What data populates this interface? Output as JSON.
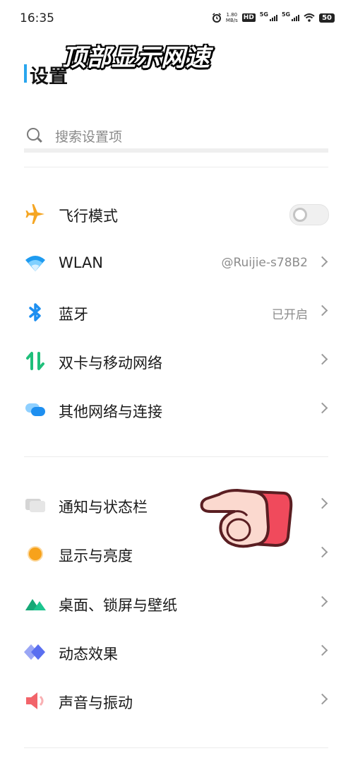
{
  "status_bar": {
    "time": "16:35",
    "net_speed_value": "1.80",
    "net_speed_unit": "MB/s",
    "hd_label": "HD",
    "signal_1": "5G",
    "signal_2": "5G",
    "battery": "50"
  },
  "overlay_caption": "顶部显示网速",
  "page_title": "设置",
  "search": {
    "placeholder": "搜索设置项"
  },
  "groups": {
    "connectivity": [
      {
        "label": "飞行模式",
        "icon": "airplane-icon",
        "control": "toggle",
        "state": "off"
      },
      {
        "label": "WLAN",
        "icon": "wifi-icon",
        "value": "@Ruijie-s78B2"
      },
      {
        "label": "蓝牙",
        "icon": "bluetooth-icon",
        "value": "已开启"
      },
      {
        "label": "双卡与移动网络",
        "icon": "mobile-data-icon"
      },
      {
        "label": "其他网络与连接",
        "icon": "other-networks-icon"
      }
    ],
    "display": [
      {
        "label": "通知与状态栏",
        "icon": "notification-icon"
      },
      {
        "label": "显示与亮度",
        "icon": "brightness-icon"
      },
      {
        "label": "桌面、锁屏与壁纸",
        "icon": "wallpaper-icon"
      },
      {
        "label": "动态效果",
        "icon": "animation-icon"
      },
      {
        "label": "声音与振动",
        "icon": "sound-icon"
      }
    ]
  },
  "colors": {
    "accent": "#2aa6ee",
    "airplane": "#f5a623",
    "wifi": "#1e9bf0",
    "bluetooth": "#1e8ff0",
    "mobile": "#1fbf7a",
    "brightness": "#f7a21b",
    "wallpaper": "#1cc58f",
    "animation": "#5a6ff0",
    "sound": "#f2646a"
  }
}
